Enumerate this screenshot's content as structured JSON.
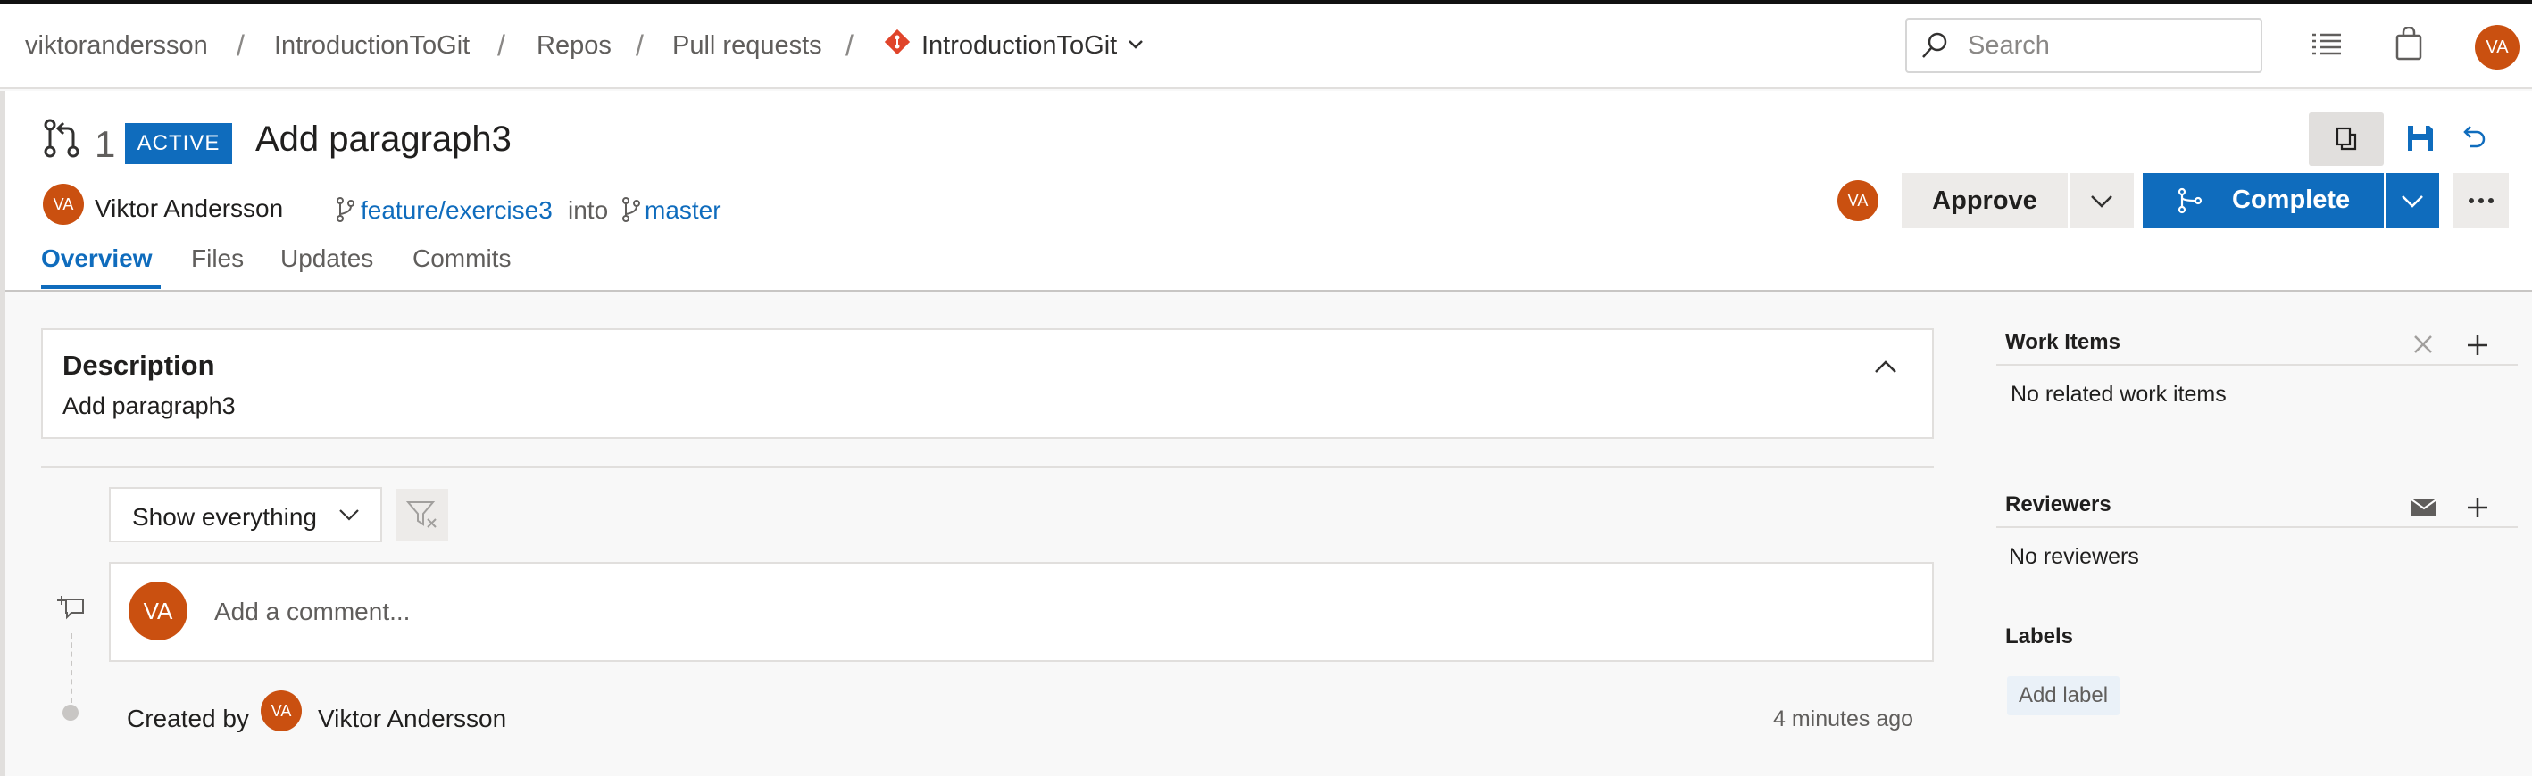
{
  "breadcrumb": {
    "org": "viktorandersson",
    "project": "IntroductionToGit",
    "repos": "Repos",
    "pull_requests": "Pull requests",
    "repo": "IntroductionToGit"
  },
  "search": {
    "placeholder": "Search"
  },
  "user": {
    "initials": "VA"
  },
  "pr": {
    "id": "1",
    "status": "ACTIVE",
    "title": "Add paragraph3",
    "author": "Viktor Andersson",
    "source_branch": "feature/exercise3",
    "into": "into",
    "target_branch": "master"
  },
  "actions": {
    "approve": "Approve",
    "complete": "Complete"
  },
  "tabs": [
    {
      "label": "Overview",
      "active": true
    },
    {
      "label": "Files",
      "active": false
    },
    {
      "label": "Updates",
      "active": false
    },
    {
      "label": "Commits",
      "active": false
    }
  ],
  "description": {
    "heading": "Description",
    "text": "Add paragraph3"
  },
  "filter": {
    "selected": "Show everything"
  },
  "comment": {
    "placeholder": "Add a comment..."
  },
  "timeline": {
    "created_by": "Created by",
    "author": "Viktor Andersson",
    "time": "4 minutes ago"
  },
  "sidebar": {
    "work_items": {
      "title": "Work Items",
      "empty": "No related work items"
    },
    "reviewers": {
      "title": "Reviewers",
      "empty": "No reviewers"
    },
    "labels": {
      "title": "Labels",
      "add": "Add label"
    }
  },
  "colors": {
    "accent": "#0f6cbd",
    "avatar": "#ca5010",
    "repo_icon": "#e0452b"
  }
}
